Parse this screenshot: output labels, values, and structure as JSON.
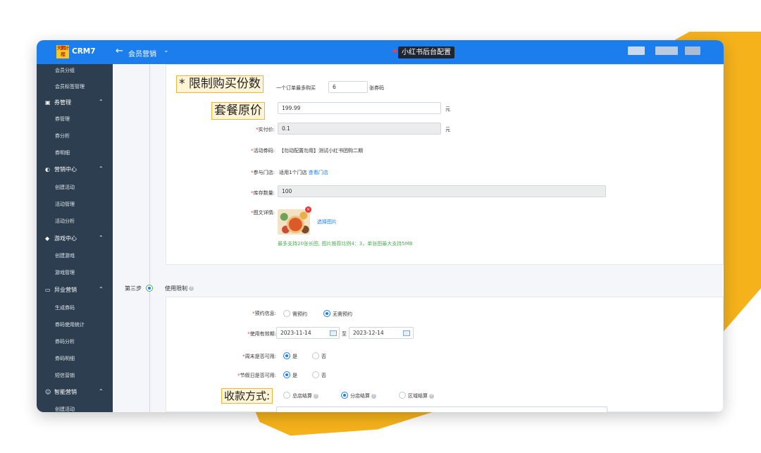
{
  "app": {
    "logo_text": "天鹅计程",
    "name": "CRM7",
    "back_icon": "arrow-left-icon",
    "module": "会员营销",
    "module_caret": "⌄",
    "center_label": "小红书后台配置"
  },
  "sidebar": {
    "items": [
      {
        "label": "会员分组"
      },
      {
        "label": "会员标签管理"
      },
      {
        "label": "券管理",
        "group": true,
        "icon": "ticket-icon"
      },
      {
        "label": "券管理"
      },
      {
        "label": "券分析"
      },
      {
        "label": "券明细"
      },
      {
        "label": "营销中心",
        "group": true,
        "icon": "marketing-icon"
      },
      {
        "label": "创建活动"
      },
      {
        "label": "活动管理"
      },
      {
        "label": "活动分析"
      },
      {
        "label": "游戏中心",
        "group": true,
        "icon": "game-icon"
      },
      {
        "label": "创建游戏"
      },
      {
        "label": "游戏管理"
      },
      {
        "label": "异业营销",
        "group": true,
        "icon": "partner-icon"
      },
      {
        "label": "生成券码"
      },
      {
        "label": "券码使用统计"
      },
      {
        "label": "券码分析"
      },
      {
        "label": "券码明细"
      },
      {
        "label": "短信营销"
      },
      {
        "label": "智能营销",
        "group": true,
        "icon": "smart-icon"
      },
      {
        "label": "创建活动"
      }
    ]
  },
  "form1": {
    "limit_label": "* 限制购买份数",
    "limit_prefix": "一个订单最多购买",
    "limit_value": "6",
    "limit_suffix": "张券码",
    "origin_price_label": "套餐原价",
    "origin_price_value": "199.99",
    "origin_price_unit": "元",
    "actual_price_label": "实付价:",
    "actual_price_value": "0.1",
    "actual_price_unit": "元",
    "coupon_label": "活动券码:",
    "coupon_value": "【勿动配置勿用】测试小红书团购二期",
    "store_label": "参与门店:",
    "store_value": "适用1个门店",
    "store_link": "查看门店",
    "stock_label": "库存数量:",
    "stock_value": "100",
    "image_label": "图文详情:",
    "image_link": "选择图片",
    "image_note": "最多支持20张长图, 图片推荐比例4：3，单张图最大支持5MB"
  },
  "step3": {
    "step_label": "第三步",
    "title": "使用限制"
  },
  "form2": {
    "booking_label": "预约信息:",
    "booking_opt1": "需预约",
    "booking_opt2": "无需预约",
    "validity_label": "使用有效期:",
    "date_start": "2023-11-14",
    "date_sep": "至",
    "date_end": "2023-12-14",
    "weekend_label": "周末是否可用:",
    "holiday_label": "节假日是否可用:",
    "yes": "是",
    "no": "否",
    "payment_label": "收款方式:",
    "pay_opt1": "总店结算",
    "pay_opt2": "分店结算",
    "pay_opt3": "区域结算"
  },
  "colors": {
    "brand": "#1c7ded",
    "sidebar": "#2c3e50",
    "accent_blob": "#f6b21b",
    "callout_border": "#f0b63c"
  }
}
